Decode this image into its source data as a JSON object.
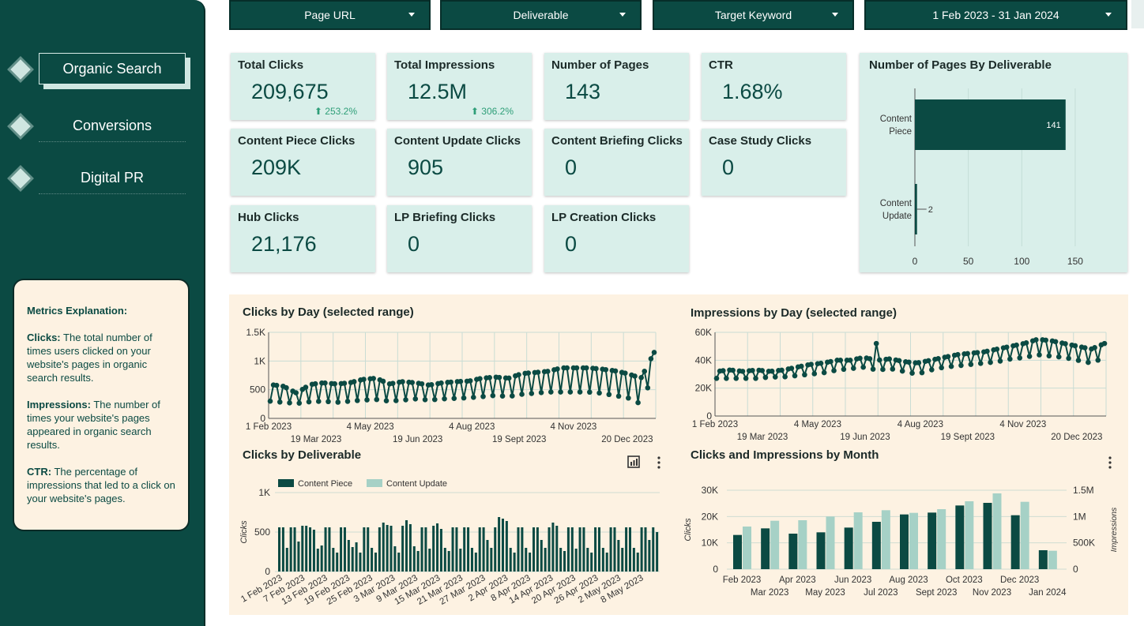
{
  "sidebar": {
    "items": [
      {
        "label": "Organic Search",
        "active": true
      },
      {
        "label": "Conversions",
        "active": false
      },
      {
        "label": "Digital PR",
        "active": false
      }
    ],
    "explanation": {
      "heading": "Metrics Explanation:",
      "clicks_term": "Clicks:",
      "clicks_text": "The total number of times users clicked on your website's pages in organic search results.",
      "impressions_term": "Impressions:",
      "impressions_text": "The number of times your website's pages appeared in organic search results.",
      "ctr_term": "CTR:",
      "ctr_text": "The percentage of impressions that led to a click on your website's pages."
    }
  },
  "filters": [
    {
      "label": "Page URL"
    },
    {
      "label": "Deliverable"
    },
    {
      "label": "Target Keyword"
    },
    {
      "label": "1 Feb 2023 - 31 Jan 2024"
    }
  ],
  "scorecards": [
    {
      "title": "Total Clicks",
      "value": "209,675",
      "delta": "⬆ 253.2%"
    },
    {
      "title": "Total Impressions",
      "value": "12.5M",
      "delta": "⬆ 306.2%"
    },
    {
      "title": "Number of Pages",
      "value": "143",
      "delta": ""
    },
    {
      "title": "CTR",
      "value": "1.68%",
      "delta": ""
    },
    {
      "title": "Content Piece Clicks",
      "value": "209K",
      "delta": ""
    },
    {
      "title": "Content Update Clicks",
      "value": "905",
      "delta": ""
    },
    {
      "title": "Content Briefing Clicks",
      "value": "0",
      "delta": ""
    },
    {
      "title": "Case Study Clicks",
      "value": "0",
      "delta": ""
    },
    {
      "title": "Hub Clicks",
      "value": "21,176",
      "delta": ""
    },
    {
      "title": "LP Briefing Clicks",
      "value": "0",
      "delta": ""
    },
    {
      "title": "LP Creation Clicks",
      "value": "0",
      "delta": ""
    }
  ],
  "colors": {
    "dark": "#0b4a43",
    "light_bar": "#a6d1c6",
    "card": "#d9efea",
    "panel": "#fdf2e2"
  },
  "chart_data": [
    {
      "type": "bar",
      "orientation": "horizontal",
      "title": "Number of Pages By Deliverable",
      "categories": [
        "Content\nPiece",
        "Content\nUpdate"
      ],
      "values": [
        141,
        2
      ],
      "xticks": [
        "0",
        "50",
        "100",
        "150"
      ],
      "xlim": [
        0,
        170
      ],
      "grid": true
    },
    {
      "type": "line",
      "title": "Clicks by Day (selected range)",
      "yticks": [
        "0",
        "500",
        "1K",
        "1.5K"
      ],
      "ylim": [
        0,
        1500
      ],
      "xticks_top": [
        "1 Feb 2023",
        "4 May 2023",
        "4 Aug 2023",
        "4 Nov 2023"
      ],
      "xticks_bottom": [
        "19 Mar 2023",
        "19 Jun 2023",
        "19 Sept 2023",
        "20 Dec 2023"
      ],
      "series": [
        {
          "values": [
            590,
            560,
            440,
            590,
            620,
            600,
            620,
            680,
            700,
            600,
            640,
            620,
            580,
            620,
            640,
            650,
            700,
            720,
            700,
            780,
            800,
            820,
            880,
            880,
            880,
            860,
            830,
            780,
            700,
            1150
          ]
        },
        {
          "values": [
            300,
            280,
            260,
            290,
            300,
            280,
            300,
            320,
            330,
            300,
            320,
            340,
            320,
            340,
            350,
            360,
            380,
            400,
            380,
            420,
            440,
            460,
            460,
            460,
            460,
            440,
            400,
            360,
            250,
            800
          ]
        }
      ],
      "grid": true
    },
    {
      "type": "line",
      "title": "Impressions by Day (selected range)",
      "yticks": [
        "0",
        "20K",
        "40K",
        "60K"
      ],
      "ylim": [
        0,
        60000
      ],
      "xticks_top": [
        "1 Feb 2023",
        "4 May 2023",
        "4 Aug 2023",
        "4 Nov 2023"
      ],
      "xticks_bottom": [
        "19 Mar 2023",
        "19 Jun 2023",
        "19 Sept 2023",
        "20 Dec 2023"
      ],
      "series": [
        {
          "values": [
            32000,
            33000,
            32000,
            33000,
            32000,
            33000,
            35000,
            37000,
            38000,
            40000,
            40000,
            42000,
            40000,
            41000,
            39000,
            38000,
            40000,
            42000,
            44000,
            45000,
            46000,
            48000,
            50000,
            52000,
            55000,
            54000,
            52000,
            50000,
            48000,
            52000
          ]
        },
        {
          "values": [
            27000,
            27000,
            27000,
            27000,
            28000,
            28000,
            29000,
            30000,
            31000,
            33000,
            34000,
            35000,
            33000,
            34000,
            32000,
            30000,
            33000,
            35000,
            36000,
            37000,
            38000,
            39000,
            41000,
            42000,
            44000,
            43000,
            42000,
            40000,
            38000,
            42000
          ]
        }
      ],
      "spike": {
        "label": "",
        "value": 52000
      },
      "grid": true
    },
    {
      "type": "bar",
      "title": "Clicks by Deliverable",
      "ylabel": "Clicks",
      "yticks": [
        "0",
        "500",
        "1K"
      ],
      "ylim": [
        0,
        1000
      ],
      "legend": [
        "Content Piece",
        "Content Update"
      ],
      "xticks": [
        "1 Feb 2023",
        "7 Feb 2023",
        "13 Feb 2023",
        "19 Feb 2023",
        "25 Feb 2023",
        "3 Mar 2023",
        "9 Mar 2023",
        "15 Mar 2023",
        "21 Mar 2023",
        "27 Mar 2023",
        "2 Apr 2023",
        "8 Apr 2023",
        "14 Apr 2023",
        "20 Apr 2023",
        "26 Apr 2023",
        "2 May 2023",
        "8 May 2023"
      ],
      "values": [
        560,
        560,
        300,
        560,
        560,
        380,
        580,
        580,
        560,
        530,
        290,
        330,
        560,
        560,
        300,
        240,
        560,
        560,
        400,
        310,
        370,
        240,
        560,
        560,
        300,
        240,
        560,
        620,
        590,
        580,
        320,
        240,
        580,
        650,
        600,
        320,
        260,
        560,
        560,
        290,
        580,
        610,
        540,
        300,
        260,
        560,
        560,
        290,
        560,
        560,
        300,
        240,
        560,
        560,
        400,
        300,
        560,
        690,
        670,
        640,
        300,
        240,
        560,
        560,
        300,
        240,
        560,
        560,
        400,
        300,
        560,
        620,
        580,
        300,
        260,
        560,
        560,
        290,
        560,
        560,
        300,
        240,
        560,
        560,
        300,
        240,
        560,
        560,
        400,
        300,
        560,
        560,
        300,
        240,
        560,
        560,
        400,
        560,
        500
      ]
    },
    {
      "type": "bar",
      "title": "Clicks and  Impressions by Month",
      "ylabel_left": "Clicks",
      "ylabel_right": "Impressions",
      "yticks_left": [
        "0",
        "10K",
        "20K",
        "30K"
      ],
      "yticks_right": [
        "0",
        "500K",
        "1M",
        "1.5M"
      ],
      "categories_top": [
        "Feb 2023",
        "Apr 2023",
        "Jun 2023",
        "Aug 2023",
        "Oct 2023",
        "Dec 2023"
      ],
      "categories_bottom": [
        "Mar 2023",
        "May 2023",
        "Jul 2023",
        "Sept 2023",
        "Nov 2023",
        "Jan 2024"
      ],
      "series": [
        {
          "name": "Clicks",
          "values": [
            13000,
            15500,
            13500,
            14000,
            15800,
            18000,
            20800,
            21500,
            24200,
            25200,
            20500,
            7200
          ]
        },
        {
          "name": "Impressions",
          "values": [
            810000,
            920000,
            930000,
            1000000,
            1080000,
            1120000,
            1070000,
            1140000,
            1290000,
            1440000,
            1280000,
            350000
          ]
        }
      ],
      "ylim_left": [
        0,
        30000
      ],
      "ylim_right": [
        0,
        1500000
      ]
    }
  ]
}
